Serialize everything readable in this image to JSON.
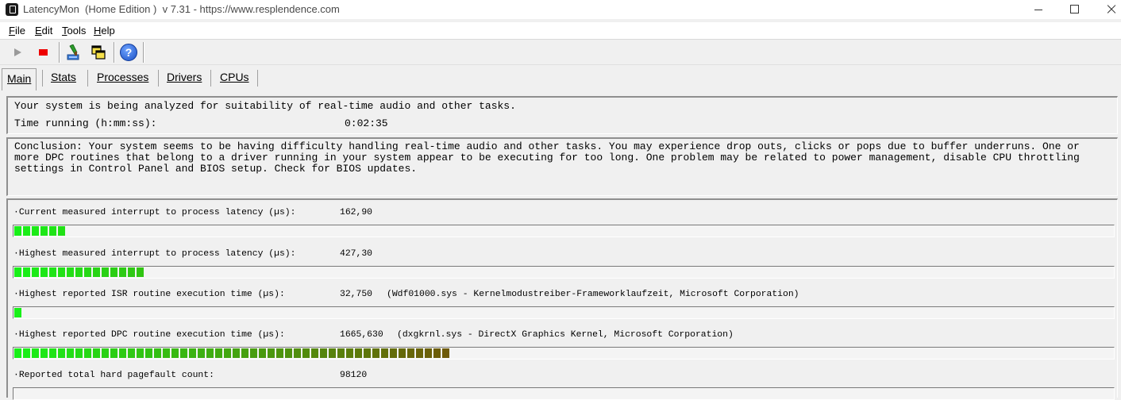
{
  "window": {
    "title": "LatencyMon  (Home Edition )  v 7.31 - https://www.resplendence.com"
  },
  "menu": [
    "File",
    "Edit",
    "Tools",
    "Help"
  ],
  "toolbar": {
    "icons": [
      "play-icon",
      "stop-icon",
      "tools-icon",
      "windows-icon",
      "help-icon"
    ],
    "help_glyph": "?"
  },
  "tabs": [
    {
      "label": "Main",
      "active": true
    },
    {
      "label": "Stats",
      "active": false
    },
    {
      "label": "Processes",
      "active": false
    },
    {
      "label": "Drivers",
      "active": false
    },
    {
      "label": "CPUs",
      "active": false
    }
  ],
  "status": {
    "analyze_text": "Your system is being analyzed for suitability of real-time audio and other tasks.",
    "time_label": "Time running (h:mm:ss):",
    "time_value": "0:02:35"
  },
  "conclusion": "Conclusion: Your system seems to be having difficulty handling real-time audio and other tasks. You may experience drop outs, clicks or pops due to buffer underruns. One or more DPC routines that belong to a driver running in your system appear to be executing for too long. One problem may be related to power management, disable CPU throttling settings in Control Panel and BIOS setup. Check for BIOS updates.",
  "metrics": [
    {
      "label": "·Current measured interrupt to process latency (µs):",
      "value": "162,90",
      "detail": "",
      "segments": 6
    },
    {
      "label": "·Highest measured interrupt to process latency (µs):",
      "value": "427,30",
      "detail": "",
      "segments": 15
    },
    {
      "label": "·Highest reported ISR routine execution time (µs):",
      "value": "32,750",
      "detail": "(Wdf01000.sys - Kernelmodustreiber-Frameworklaufzeit, Microsoft Corporation)",
      "segments": 1
    },
    {
      "label": "·Highest reported DPC routine execution time (µs):",
      "value": "1665,630",
      "detail": "(dxgkrnl.sys - DirectX Graphics Kernel, Microsoft Corporation)",
      "segments": 50
    },
    {
      "label": "·Reported total hard pagefault count:",
      "value": "98120",
      "detail": "",
      "segments": 0
    }
  ],
  "colors": {
    "bar_start": "#18f018",
    "bar_end": "#6e5a08"
  }
}
